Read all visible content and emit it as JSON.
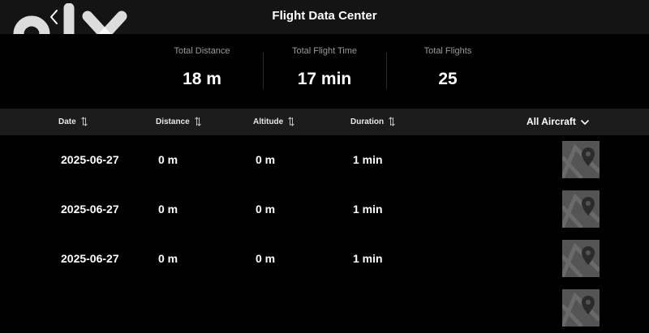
{
  "header": {
    "title": "Flight Data Center",
    "back_icon": "chevron-left-icon"
  },
  "stats": [
    {
      "label": "Total Distance",
      "value": "18 m"
    },
    {
      "label": "Total Flight Time",
      "value": "17 min"
    },
    {
      "label": "Total Flights",
      "value": "25"
    }
  ],
  "table": {
    "columns": [
      {
        "label": "Date",
        "sort_icon": "sort-icon"
      },
      {
        "label": "Distance",
        "sort_icon": "sort-icon"
      },
      {
        "label": "Altitude",
        "sort_icon": "sort-icon"
      },
      {
        "label": "Duration",
        "sort_icon": "sort-icon"
      }
    ],
    "filter": {
      "label": "All Aircraft",
      "icon": "chevron-down-icon"
    },
    "rows": [
      {
        "date": "2025-06-27",
        "distance": "0 m",
        "altitude": "0 m",
        "duration": "1 min",
        "icon": "map-pin-icon"
      },
      {
        "date": "2025-06-27",
        "distance": "0 m",
        "altitude": "0 m",
        "duration": "1 min",
        "icon": "map-pin-icon"
      },
      {
        "date": "2025-06-27",
        "distance": "0 m",
        "altitude": "0 m",
        "duration": "1 min",
        "icon": "map-pin-icon"
      },
      {
        "date": "",
        "distance": "",
        "altitude": "",
        "duration": "",
        "icon": "map-pin-icon"
      }
    ]
  },
  "watermark": {
    "text": "olx"
  },
  "colors": {
    "background": "#000000",
    "header_bar": "#141414",
    "table_header": "#1c1c1c",
    "muted_text": "#9a9a9a",
    "map_tile": "#545454"
  }
}
